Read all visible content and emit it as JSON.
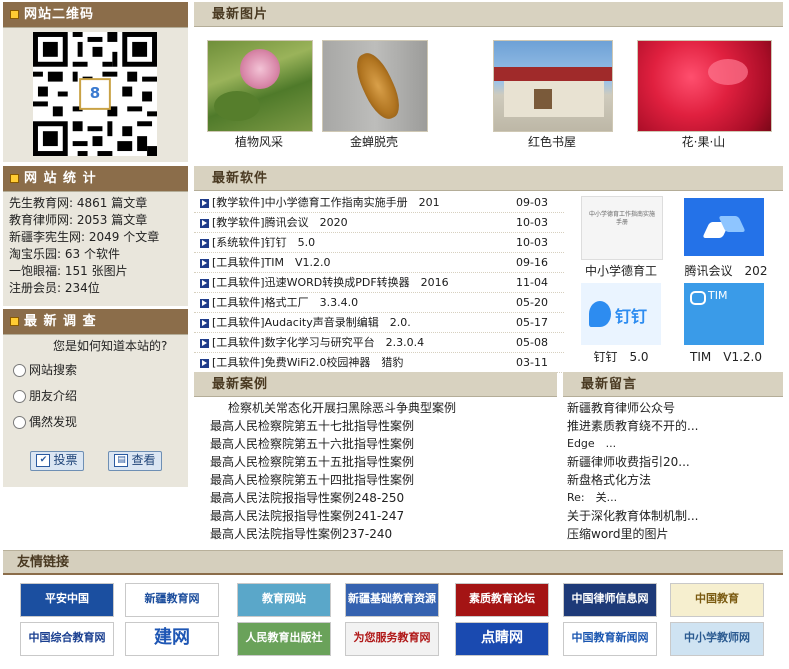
{
  "qr_section": {
    "title": "网站二维码",
    "logo_text": "8"
  },
  "stats": {
    "title": "网 站 统 计",
    "items": [
      "先生教育网: 4861 篇文章",
      "教育律师网: 2053 篇文章",
      "新疆李宪生网: 2049 个文章",
      "淘宝乐园: 63 个软件",
      "一饱眼福: 151 张图片",
      "注册会员: 234位"
    ]
  },
  "survey": {
    "title": "最 新 调 查",
    "question": "您是如何知道本站的?",
    "options": [
      "网站搜索",
      "朋友介绍",
      "偶然发现"
    ],
    "vote_label": "投票",
    "view_label": "查看"
  },
  "photos": {
    "title": "最新图片",
    "items": [
      {
        "caption": "植物风采"
      },
      {
        "caption": "金蝉脱壳"
      },
      {
        "caption": "红色书屋"
      },
      {
        "caption": "花·果·山"
      }
    ]
  },
  "software": {
    "title": "最新软件",
    "rows": [
      {
        "title": "[教学软件]中小学德育工作指南实施手册　201",
        "date": "09-03"
      },
      {
        "title": "[教学软件]腾讯会议　2020",
        "date": "10-03"
      },
      {
        "title": "[系统软件]钉钉　5.0",
        "date": "10-03"
      },
      {
        "title": "[工具软件]TIM　V1.2.0",
        "date": "09-16"
      },
      {
        "title": "[工具软件]迅速WORD转换成PDF转换器　2016",
        "date": "11-04"
      },
      {
        "title": "[工具软件]格式工厂　3.3.4.0",
        "date": "05-20"
      },
      {
        "title": "[工具软件]Audacity声音录制编辑　2.0.",
        "date": "05-17"
      },
      {
        "title": "[工具软件]数字化学习与研究平台　2.3.0.4",
        "date": "05-08"
      },
      {
        "title": "[工具软件]免费WiFi2.0校园神器　猎豹",
        "date": "03-11"
      }
    ],
    "tiles": [
      {
        "caption": "中小学德育工",
        "thumb_text": "中小学德育工作指南实施手册"
      },
      {
        "caption": "腾讯会议　202",
        "thumb_text": ""
      },
      {
        "caption": "钉钉　5.0",
        "thumb_text": "钉钉"
      },
      {
        "caption": "TIM　V1.2.0",
        "thumb_text": "TIM"
      }
    ]
  },
  "cases": {
    "title": "最新案例",
    "items": [
      "检察机关常态化开展扫黑除恶斗争典型案例",
      "最高人民检察院第五十七批指导性案例",
      "最高人民检察院第五十六批指导性案例",
      "最高人民检察院第五十五批指导性案例",
      "最高人民检察院第五十四批指导性案例",
      "最高人民法院报指导性案例248-250",
      "最高人民法院报指导性案例241-247",
      "最高人民法院指导性案例237-240"
    ]
  },
  "messages": {
    "title": "最新留言",
    "items": [
      "新疆教育律师公众号",
      "推进素质教育绕不开的...",
      "Edge　...",
      "新疆律师收费指引20...",
      "新盘格式化方法",
      "Re:　关...",
      "关于深化教育体制机制...",
      "压缩word里的图片"
    ]
  },
  "links": {
    "title": "友情链接",
    "row1": [
      {
        "text": "平安中国",
        "bg": "#1b4fa0",
        "fg": "#ffffff"
      },
      {
        "text": "新疆教育网",
        "bg": "#ffffff",
        "fg": "#1a4c9c"
      },
      {
        "text": "教育网站",
        "bg": "#5aa7c9",
        "fg": "#ffffff"
      },
      {
        "text": "新疆基础教育资源网",
        "bg": "#3562b0",
        "fg": "#ffffff"
      },
      {
        "text": "素质教育论坛",
        "bg": "#a41414",
        "fg": "#ffffff"
      },
      {
        "text": "中国律师信息网",
        "bg": "#1e3a78",
        "fg": "#ffffff"
      },
      {
        "text": "中国教育",
        "bg": "#f6efcf",
        "fg": "#7a5a10"
      }
    ],
    "row2": [
      {
        "text": "中国综合教育网",
        "bg": "#ffffff",
        "fg": "#1a3f90"
      },
      {
        "text": "建网",
        "bg": "#ffffff",
        "fg": "#1e56b4"
      },
      {
        "text": "人民教育出版社",
        "bg": "#6aa25a",
        "fg": "#ffffff"
      },
      {
        "text": "为您服务教育网",
        "bg": "#f2f2f2",
        "fg": "#b01818"
      },
      {
        "text": "点睛网",
        "bg": "#1a4ab0",
        "fg": "#ffffff"
      },
      {
        "text": "中国教育新闻网",
        "bg": "#ffffff",
        "fg": "#1a56b0"
      },
      {
        "text": "中小学教师网",
        "bg": "#cfe3f2",
        "fg": "#2a5a90"
      }
    ]
  }
}
